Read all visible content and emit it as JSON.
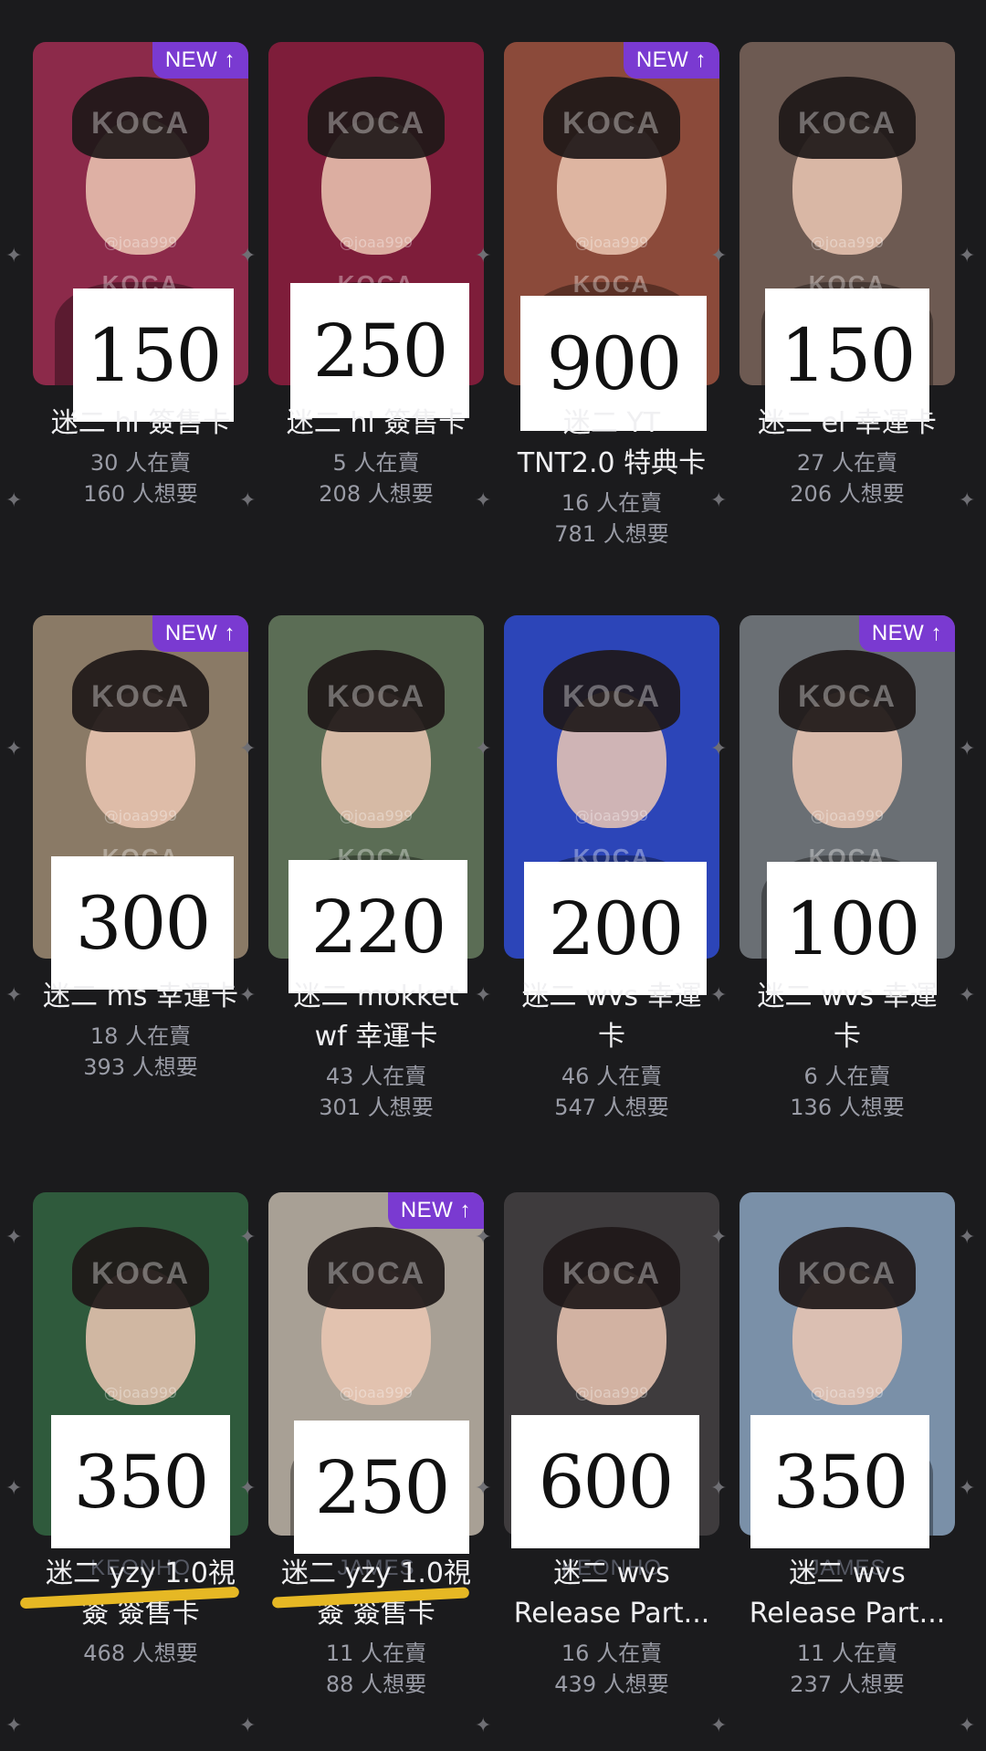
{
  "badge_text": "NEW ↑",
  "watermark_text": "KOCA",
  "handle_text": "@joaa999",
  "colors": {
    "background": "#1b1b1d",
    "badge": "#7a3ad1",
    "highlight": "#e6b824"
  },
  "cards": [
    {
      "price": "150",
      "new": true,
      "title": "迷二 hl 簽售卡",
      "title2": "",
      "sellers": "30 人在賣",
      "wanted": "160 人想要",
      "bg": "#8c2a4a"
    },
    {
      "price": "250",
      "new": false,
      "title": "迷二 hl 簽售卡",
      "title2": "",
      "sellers": "5 人在賣",
      "wanted": "208 人想要",
      "bg": "#7e1d3a"
    },
    {
      "price": "900",
      "new": true,
      "title": "迷二 YT",
      "title2": "TNT2.0 特典卡",
      "sellers": "16 人在賣",
      "wanted": "781 人想要",
      "bg": "#8b4a3a"
    },
    {
      "price": "150",
      "new": false,
      "title": "迷二 el 幸運卡",
      "title2": "",
      "sellers": "27 人在賣",
      "wanted": "206 人想要",
      "bg": "#6d5a52"
    },
    {
      "price": "300",
      "new": true,
      "title": "迷二 ms 幸運卡",
      "title2": "",
      "sellers": "18 人在賣",
      "wanted": "393 人想要",
      "bg": "#8a7a66"
    },
    {
      "price": "220",
      "new": false,
      "title": "迷二 mokket",
      "title2": "wf 幸運卡",
      "sellers": "43 人在賣",
      "wanted": "301 人想要",
      "bg": "#5b6d55"
    },
    {
      "price": "200",
      "new": false,
      "title": "迷二 wvs 幸運",
      "title2": "卡",
      "sellers": "46 人在賣",
      "wanted": "547 人想要",
      "bg": "#2c45b8"
    },
    {
      "price": "100",
      "new": true,
      "title": "迷二 wvs 幸運",
      "title2": "卡",
      "sellers": "6 人在賣",
      "wanted": "136 人想要",
      "bg": "#6a6f74"
    },
    {
      "price": "350",
      "new": false,
      "member": "KEONHO",
      "title": "迷二 yzy 1.0視",
      "title2": "簽 簽售卡",
      "sellers": "",
      "wanted": "468 人想要",
      "bg": "#2f5a3c"
    },
    {
      "price": "250",
      "new": true,
      "member": "JAMES",
      "title": "迷二 yzy 1.0視",
      "title2": "簽 簽售卡",
      "sellers": "11 人在賣",
      "wanted": "88 人想要",
      "bg": "#a8a095"
    },
    {
      "price": "600",
      "new": false,
      "member": "KEONHO",
      "title": "迷二 wvs",
      "title2": "Release Part...",
      "sellers": "16 人在賣",
      "wanted": "439 人想要",
      "bg": "#3e3b3d"
    },
    {
      "price": "350",
      "new": false,
      "member": "JAMES",
      "title": "迷二 wvs",
      "title2": "Release Part...",
      "sellers": "11 人在賣",
      "wanted": "237 人想要",
      "bg": "#7a90a8"
    }
  ]
}
